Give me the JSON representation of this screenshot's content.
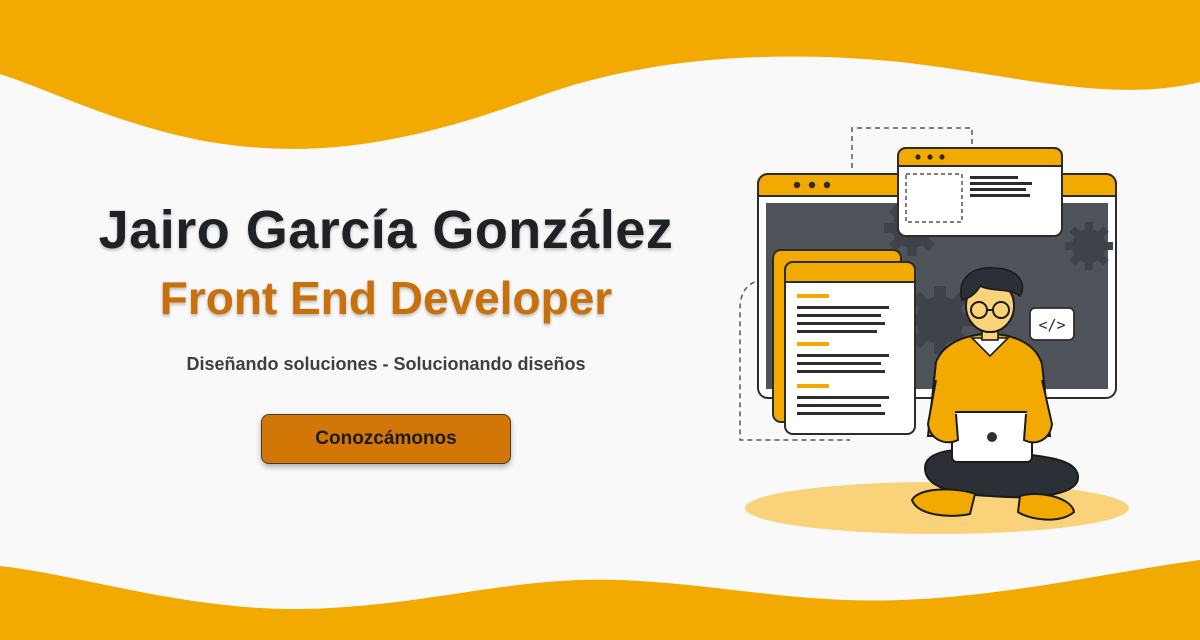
{
  "hero": {
    "name": "Jairo García González",
    "role": "Front End Developer",
    "tagline": "Diseñando soluciones - Solucionando diseños",
    "cta_label": "Conozcámonos"
  },
  "illustration": {
    "code_badge": "</>"
  },
  "colors": {
    "wave": "#f2a900",
    "background": "#f9f9f9",
    "name_text": "#1e2126",
    "role_text": "#c8700b",
    "button": "#d27707",
    "ellipse": "#f9d27a"
  }
}
